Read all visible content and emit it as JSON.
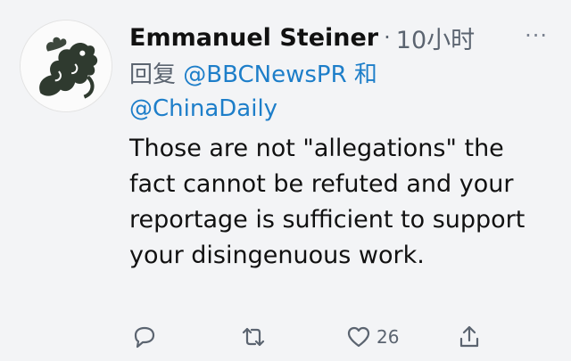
{
  "tweet": {
    "author_name": "Emmanuel Steiner",
    "separator": "·",
    "time": "10小时",
    "more": "···",
    "reply_prefix": "回复",
    "reply_to_1": "@BBCNewsPR",
    "reply_connector": "和",
    "reply_to_2": "@ChinaDaily",
    "text": "Those are not \"allegations\" the fact cannot be refuted and your reportage is sufficient to support your disingenuous work.",
    "like_count": "26"
  },
  "icons": {
    "reply": "reply-icon",
    "retweet": "retweet-icon",
    "like": "heart-icon",
    "share": "share-icon"
  },
  "colors": {
    "mention": "#1d7ec9",
    "secondary_text": "#5b6470",
    "background": "#f3f4f6"
  }
}
